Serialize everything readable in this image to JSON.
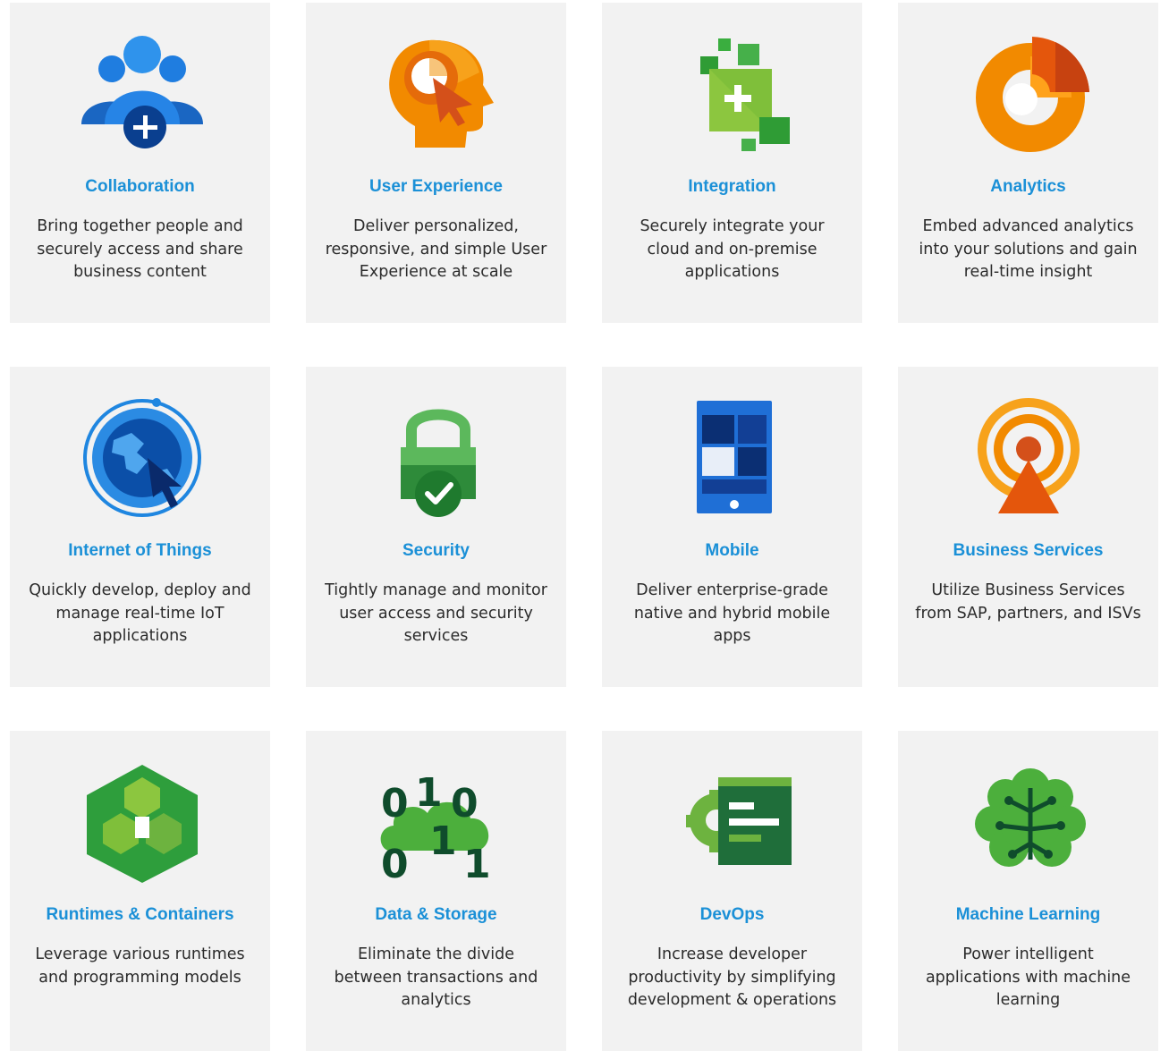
{
  "tiles": [
    {
      "title": "Collaboration",
      "desc": "Bring together people and securely access and share business content",
      "icon": "collaboration-icon"
    },
    {
      "title": "User Experience",
      "desc": "Deliver personalized, responsive, and simple User Experience at scale",
      "icon": "user-experience-icon"
    },
    {
      "title": "Integration",
      "desc": "Securely integrate your cloud and on-premise applications",
      "icon": "integration-icon"
    },
    {
      "title": "Analytics",
      "desc": "Embed advanced analytics into your solutions and gain real-time insight",
      "icon": "analytics-icon"
    },
    {
      "title": "Internet of Things",
      "desc": "Quickly develop, deploy and manage real-time IoT applications",
      "icon": "globe-icon"
    },
    {
      "title": "Security",
      "desc": "Tightly manage and monitor user access and security services",
      "icon": "lock-icon"
    },
    {
      "title": "Mobile",
      "desc": "Deliver enterprise-grade native and hybrid mobile apps",
      "icon": "mobile-icon"
    },
    {
      "title": "Business Services",
      "desc": "Utilize Business Services from SAP, partners, and ISVs",
      "icon": "broadcast-icon"
    },
    {
      "title": "Runtimes & Containers",
      "desc": "Leverage various runtimes and programming models",
      "icon": "containers-icon"
    },
    {
      "title": "Data & Storage",
      "desc": "Eliminate the divide between transactions and analytics",
      "icon": "data-storage-icon"
    },
    {
      "title": "DevOps",
      "desc": "Increase developer productivity by simplifying development & operations",
      "icon": "devops-icon"
    },
    {
      "title": "Machine Learning",
      "desc": "Power intelligent applications with machine learning",
      "icon": "brain-icon"
    }
  ],
  "colors": {
    "tile_bg": "#f2f2f2",
    "title": "#1b90d7",
    "text": "#2b2b2b"
  }
}
